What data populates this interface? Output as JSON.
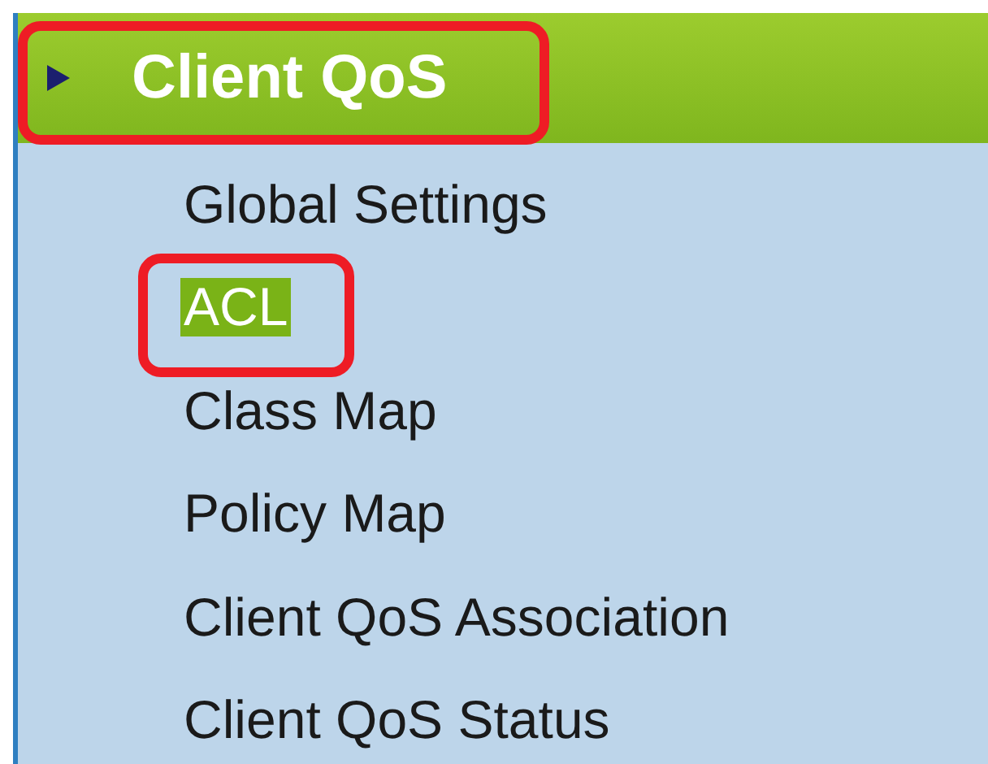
{
  "menu": {
    "title": "Client QoS",
    "expanded": false,
    "highlighted": true,
    "items": [
      {
        "label": "Global Settings",
        "selected": false,
        "highlighted": false
      },
      {
        "label": "ACL",
        "selected": true,
        "highlighted": true
      },
      {
        "label": "Class Map",
        "selected": false,
        "highlighted": false
      },
      {
        "label": "Policy Map",
        "selected": false,
        "highlighted": false
      },
      {
        "label": "Client QoS Association",
        "selected": false,
        "highlighted": false
      },
      {
        "label": "Client QoS Status",
        "selected": false,
        "highlighted": false
      }
    ]
  }
}
